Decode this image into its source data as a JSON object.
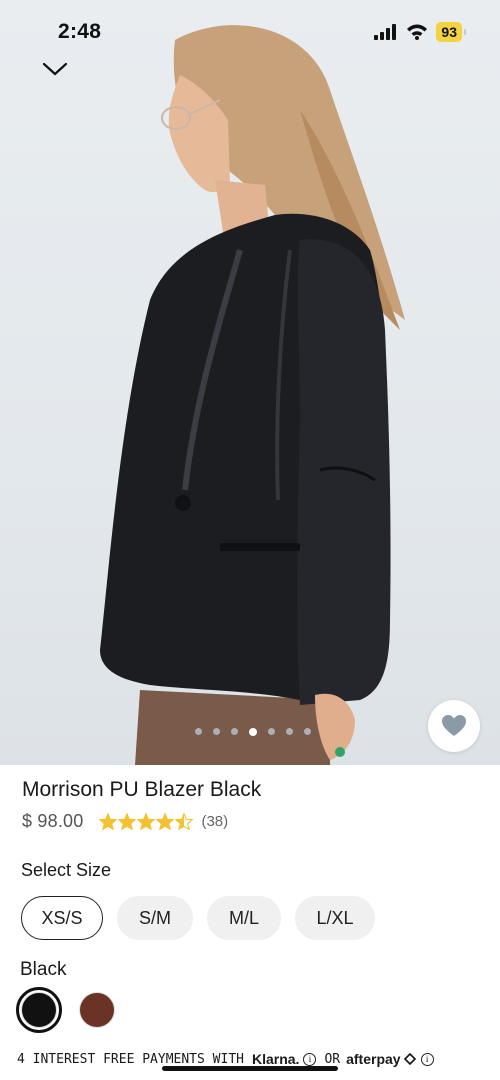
{
  "status_bar": {
    "time": "2:48",
    "battery": "93",
    "icons": [
      "signal-icon",
      "wifi-icon",
      "battery-icon"
    ]
  },
  "navigation": {
    "collapse_icon": "chevron-down-icon"
  },
  "gallery": {
    "image_count": 7,
    "active_index": 3,
    "wishlist_icon": "heart-icon"
  },
  "product": {
    "title": "Morrison PU Blazer Black",
    "price": "$ 98.00",
    "rating": 4.5,
    "review_count": "(38)"
  },
  "size": {
    "label": "Select Size",
    "options": [
      "XS/S",
      "S/M",
      "M/L",
      "L/XL"
    ],
    "selected": "XS/S"
  },
  "color": {
    "label": "Black",
    "options": [
      {
        "name": "Black",
        "hex": "#111111"
      },
      {
        "name": "Brown",
        "hex": "#6b3325"
      }
    ]
  },
  "payments": {
    "text": "4 INTEREST FREE PAYMENTS WITH",
    "klarna": "Klarna.",
    "or": "OR",
    "afterpay": "afterpay"
  },
  "colors": {
    "star": "#f2c230",
    "chip_bg": "#f0f0f0",
    "battery": "#f3d33f"
  }
}
